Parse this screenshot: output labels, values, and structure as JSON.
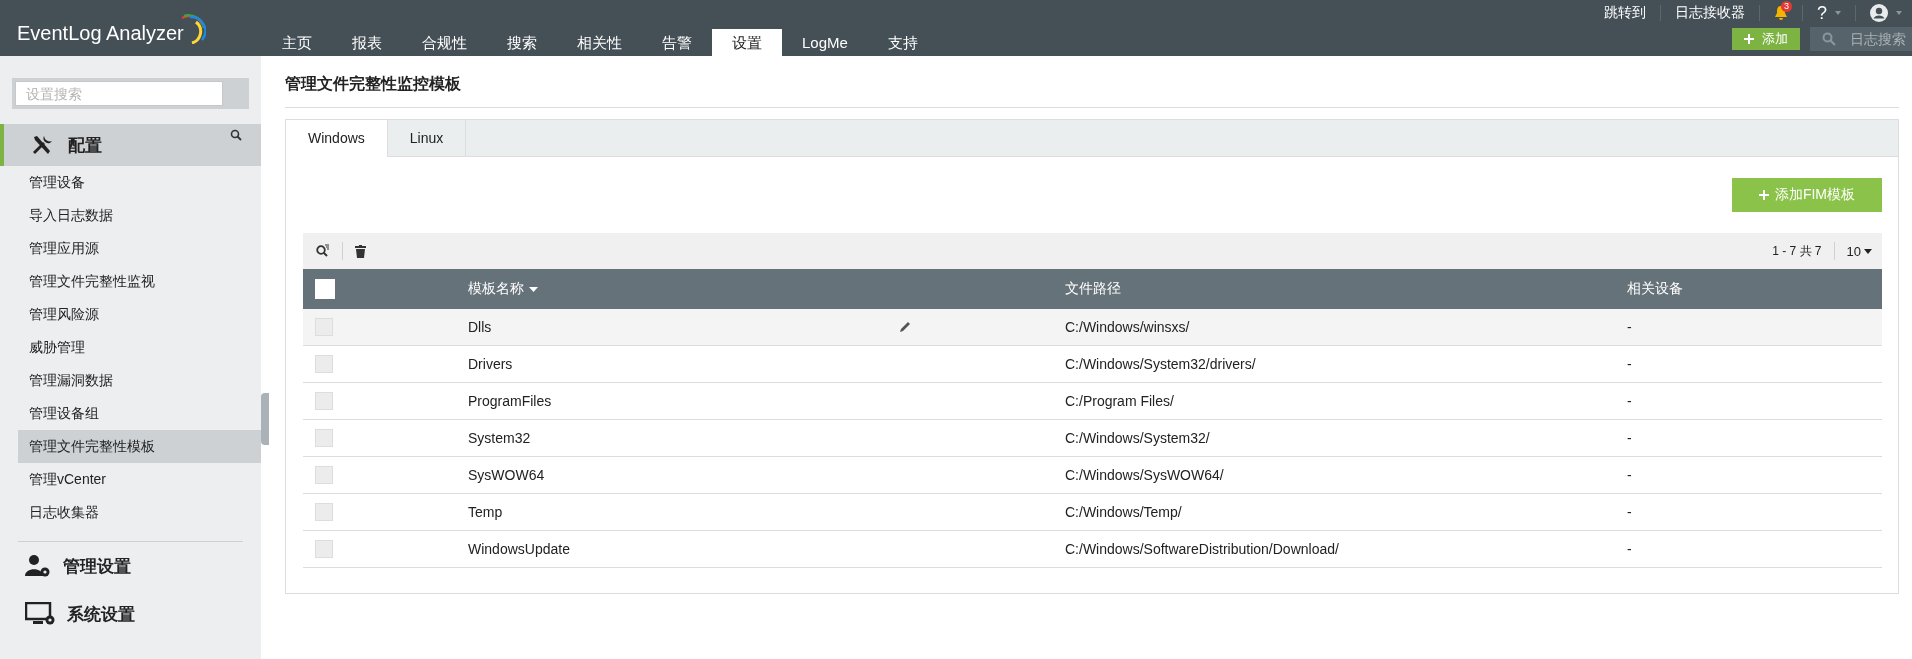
{
  "header": {
    "logo": "EventLog Analyzer",
    "nav": [
      {
        "label": "主页",
        "selected": false
      },
      {
        "label": "报表",
        "selected": false
      },
      {
        "label": "合规性",
        "selected": false
      },
      {
        "label": "搜索",
        "selected": false
      },
      {
        "label": "相关性",
        "selected": false
      },
      {
        "label": "告警",
        "selected": false
      },
      {
        "label": "设置",
        "selected": true
      },
      {
        "label": "LogMe",
        "selected": false
      },
      {
        "label": "支持",
        "selected": false
      }
    ],
    "links": [
      "跳转到",
      "日志接收器"
    ],
    "notification_count": "3",
    "help": "?",
    "add_button": "添加",
    "search": {
      "placeholder": "日志搜索"
    }
  },
  "sidebar": {
    "search": {
      "placeholder": "设置搜索"
    },
    "section": {
      "title": "配置",
      "expanded": true
    },
    "items": [
      {
        "label": "管理设备",
        "selected": false
      },
      {
        "label": "导入日志数据",
        "selected": false
      },
      {
        "label": "管理应用源",
        "selected": false
      },
      {
        "label": "管理文件完整性监视",
        "selected": false
      },
      {
        "label": "管理风险源",
        "selected": false
      },
      {
        "label": "威胁管理",
        "selected": false
      },
      {
        "label": "管理漏洞数据",
        "selected": false
      },
      {
        "label": "管理设备组",
        "selected": false
      },
      {
        "label": "管理文件完整性模板",
        "selected": true
      },
      {
        "label": "管理vCenter",
        "selected": false
      },
      {
        "label": "日志收集器",
        "selected": false
      }
    ],
    "sections": [
      {
        "title": "管理设置",
        "kind": "user"
      },
      {
        "title": "系统设置",
        "kind": "monitor"
      }
    ]
  },
  "page": {
    "title": "管理文件完整性监控模板",
    "tabs": [
      {
        "label": "Windows",
        "selected": true
      },
      {
        "label": "Linux",
        "selected": false
      }
    ],
    "add_button": "添加FIM模板",
    "pagination": "1 - 7 共 7",
    "page_size": "10",
    "table": {
      "columns": [
        "模板名称",
        "文件路径",
        "相关设备"
      ],
      "header_checked": false,
      "rows": [
        {
          "name": "Dlls",
          "path": "C:/Windows/winsxs/",
          "devices": "-",
          "checked": false,
          "highlighted": true
        },
        {
          "name": "Drivers",
          "path": "C:/Windows/System32/drivers/",
          "devices": "-",
          "checked": false,
          "highlighted": false
        },
        {
          "name": "ProgramFiles",
          "path": "C:/Program Files/",
          "devices": "-",
          "checked": false,
          "highlighted": false
        },
        {
          "name": "System32",
          "path": "C:/Windows/System32/",
          "devices": "-",
          "checked": false,
          "highlighted": false
        },
        {
          "name": "SysWOW64",
          "path": "C:/Windows/SysWOW64/",
          "devices": "-",
          "checked": false,
          "highlighted": false
        },
        {
          "name": "Temp",
          "path": "C:/Windows/Temp/",
          "devices": "-",
          "checked": false,
          "highlighted": false
        },
        {
          "name": "WindowsUpdate",
          "path": "C:/Windows/SoftwareDistribution/Download/",
          "devices": "-",
          "checked": false,
          "highlighted": false
        }
      ]
    }
  }
}
